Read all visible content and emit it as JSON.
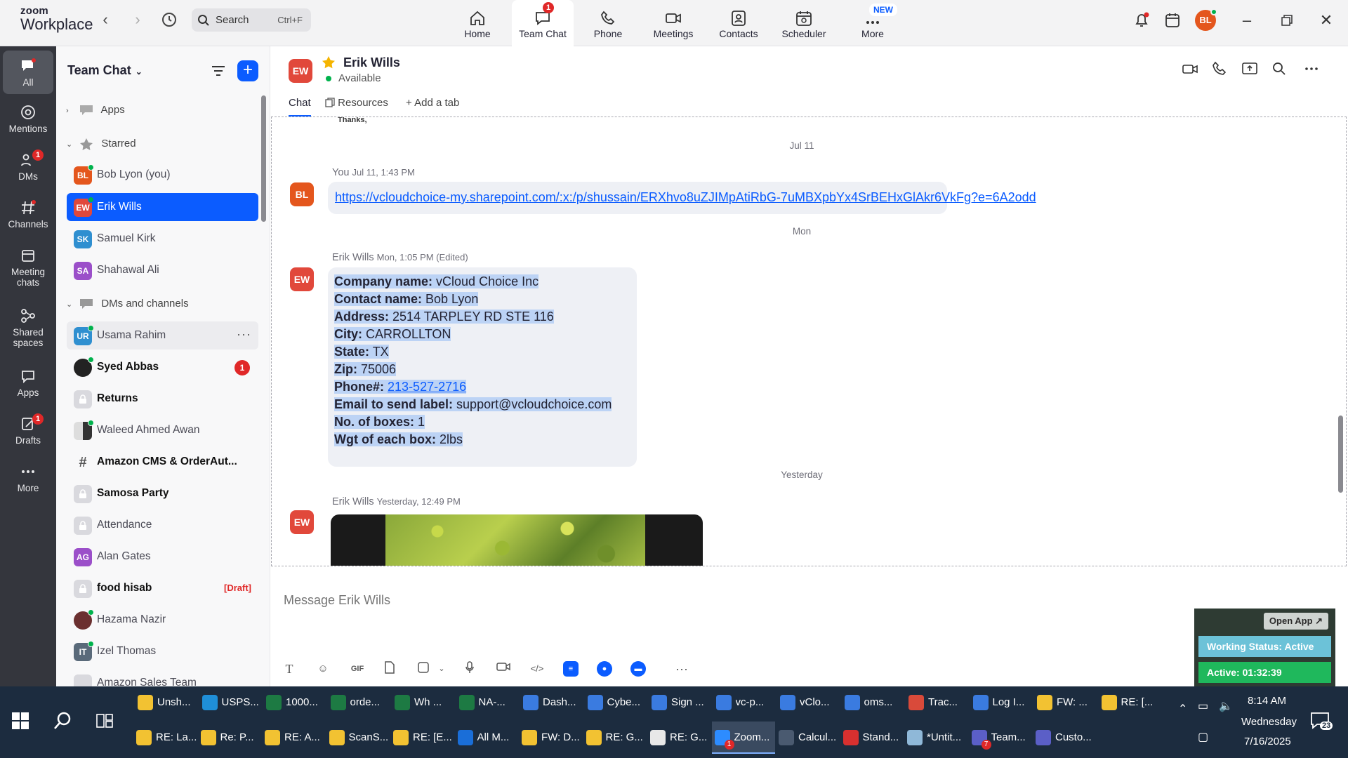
{
  "app": {
    "logo_line1": "zoom",
    "logo_line2": "Workplace"
  },
  "topbar": {
    "search_label": "Search",
    "search_shortcut": "Ctrl+F",
    "nav": [
      {
        "label": "Home"
      },
      {
        "label": "Team Chat",
        "badge": "1"
      },
      {
        "label": "Phone"
      },
      {
        "label": "Meetings"
      },
      {
        "label": "Contacts"
      },
      {
        "label": "Scheduler"
      },
      {
        "label": "More",
        "badge": "NEW"
      }
    ],
    "avatar": "BL"
  },
  "rail": [
    {
      "label": "All"
    },
    {
      "label": "Mentions"
    },
    {
      "label": "DMs",
      "badge": "1"
    },
    {
      "label": "Channels"
    },
    {
      "label": "Meeting chats"
    },
    {
      "label": "Shared spaces"
    },
    {
      "label": "Apps"
    },
    {
      "label": "Drafts",
      "badge": "1"
    },
    {
      "label": "More"
    }
  ],
  "sidebar": {
    "title": "Team Chat",
    "sections": {
      "apps": "Apps",
      "starred": "Starred",
      "dms": "DMs and channels"
    },
    "starred": [
      {
        "initials": "BL",
        "name": "Bob Lyon (you)",
        "color": "#e4561d"
      },
      {
        "initials": "EW",
        "name": "Erik Wills",
        "color": "#e1483b"
      },
      {
        "initials": "SK",
        "name": "Samuel Kirk",
        "color": "#2f8fd0"
      },
      {
        "initials": "SA",
        "name": "Shahawal Ali",
        "color": "#9b4fc9"
      }
    ],
    "dms": [
      {
        "initials": "UR",
        "name": "Usama Rahim",
        "color": "#2f8fd0"
      },
      {
        "initials": "",
        "name": "Syed Abbas",
        "badge": "1"
      },
      {
        "initials": "",
        "name": "Returns"
      },
      {
        "initials": "",
        "name": "Waleed Ahmed Awan"
      },
      {
        "initials": "#",
        "name": "Amazon CMS & OrderAut..."
      },
      {
        "initials": "",
        "name": "Samosa Party"
      },
      {
        "initials": "",
        "name": "Attendance"
      },
      {
        "initials": "AG",
        "name": "Alan Gates",
        "color": "#9b4fc9"
      },
      {
        "initials": "",
        "name": "food hisab",
        "draft": "[Draft]"
      },
      {
        "initials": "",
        "name": "Hazama Nazir"
      },
      {
        "initials": "IT",
        "name": "Izel Thomas",
        "color": "#5a6a7a"
      },
      {
        "initials": "",
        "name": "Amazon Sales Team"
      }
    ]
  },
  "chat": {
    "contact_initials": "EW",
    "contact_name": "Erik Wills",
    "status": "Available",
    "tabs": [
      "Chat",
      "Resources",
      "Add a tab"
    ],
    "cut_text": "Thanks,",
    "dates": [
      "Jul 11",
      "Mon",
      "Yesterday"
    ],
    "msg1": {
      "initials": "BL",
      "sender": "You",
      "time": "Jul 11, 1:43 PM",
      "link": "https://vcloudchoice-my.sharepoint.com/:x:/p/shussain/ERXhvo8uZJIMpAtiRbG-7uMBXpbYx4SrBEHxGlAkr6VkFg?e=6A2odd"
    },
    "msg2": {
      "initials": "EW",
      "sender": "Erik Wills",
      "time": "Mon, 1:05 PM (Edited)",
      "lines": [
        {
          "label": "Company name:",
          "value": " vCloud Choice Inc"
        },
        {
          "label": "Contact name:",
          "value": " Bob Lyon"
        },
        {
          "label": "Address:",
          "value": " 2514 TARPLEY RD STE 116"
        },
        {
          "label": "City:",
          "value": " CARROLLTON"
        },
        {
          "label": "State:",
          "value": " TX"
        },
        {
          "label": "Zip:",
          "value": " 75006"
        },
        {
          "label": "Phone#:",
          "value": "213-527-2716"
        },
        {
          "label": "Email to send label:",
          "value": " support@vcloudchoice.com"
        },
        {
          "label": "No. of boxes:",
          "value": " 1"
        },
        {
          "label": "Wgt of each box:",
          "value": " 2lbs"
        }
      ]
    },
    "msg3": {
      "initials": "EW",
      "sender": "Erik Wills",
      "time": "Yesterday, 12:49 PM"
    },
    "composer_placeholder": "Message Erik Wills"
  },
  "widget": {
    "open_app": "Open App ↗",
    "working_status": "Working Status: Active",
    "active": "Active: 01:32:39"
  },
  "taskbar": {
    "row1": [
      {
        "label": "Unsh...",
        "icon": "folder",
        "color": "#f2c232"
      },
      {
        "label": "USPS...",
        "icon": "edge",
        "color": "#1f8fd8"
      },
      {
        "label": "1000...",
        "icon": "excel",
        "color": "#1d7a43"
      },
      {
        "label": "orde...",
        "icon": "excel",
        "color": "#1d7a43"
      },
      {
        "label": "Wh ...",
        "icon": "excel",
        "color": "#1d7a43"
      },
      {
        "label": "NA-...",
        "icon": "excel",
        "color": "#1d7a43"
      },
      {
        "label": "Dash...",
        "icon": "chrome",
        "color": "#3a7be0"
      },
      {
        "label": "Cybe...",
        "icon": "chrome",
        "color": "#3a7be0"
      },
      {
        "label": "Sign ...",
        "icon": "chrome",
        "color": "#3a7be0"
      },
      {
        "label": "vc-p...",
        "icon": "chrome",
        "color": "#3a7be0"
      },
      {
        "label": "vClo...",
        "icon": "chrome",
        "color": "#3a7be0"
      },
      {
        "label": "oms...",
        "icon": "chrome",
        "color": "#3a7be0"
      },
      {
        "label": "Trac...",
        "icon": "chrome",
        "color": "#d94a3a"
      },
      {
        "label": "Log I...",
        "icon": "chrome",
        "color": "#3a7be0"
      },
      {
        "label": "FW: ...",
        "icon": "mail",
        "color": "#f2c232"
      },
      {
        "label": "RE: [...",
        "icon": "mail",
        "color": "#f2c232"
      }
    ],
    "row2": [
      {
        "label": "RE: La...",
        "icon": "mail",
        "color": "#f2c232"
      },
      {
        "label": "Re: P...",
        "icon": "mail",
        "color": "#f2c232"
      },
      {
        "label": "RE: A...",
        "icon": "mail",
        "color": "#f2c232"
      },
      {
        "label": "ScanS...",
        "icon": "mail",
        "color": "#f2c232"
      },
      {
        "label": "RE: [E...",
        "icon": "mail",
        "color": "#f2c232"
      },
      {
        "label": "All M...",
        "icon": "outlook",
        "color": "#1a6ed8"
      },
      {
        "label": "FW: D...",
        "icon": "mail",
        "color": "#f2c232"
      },
      {
        "label": "RE: G...",
        "icon": "mail",
        "color": "#f2c232"
      },
      {
        "label": "RE: G...",
        "icon": "mail",
        "color": "#e8e8e8"
      },
      {
        "label": "Zoom...",
        "icon": "zoom",
        "color": "#2d8cff",
        "badge": "1"
      },
      {
        "label": "Calcul...",
        "icon": "calc",
        "color": "#4a5a70"
      },
      {
        "label": "Stand...",
        "icon": "pdf",
        "color": "#d8302f"
      },
      {
        "label": "*Untit...",
        "icon": "notepad",
        "color": "#8fb8d8"
      },
      {
        "label": "Team...",
        "icon": "teams",
        "color": "#5b5fc7",
        "badge": "7"
      },
      {
        "label": "Custo...",
        "icon": "teams",
        "color": "#5b5fc7"
      }
    ],
    "time": "8:14 AM",
    "day": "Wednesday",
    "date": "7/16/2025",
    "notif_count": "23"
  }
}
